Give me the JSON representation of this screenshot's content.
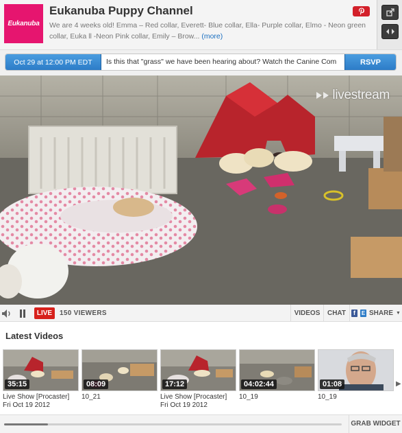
{
  "channel": {
    "logo_text": "Eukanuba",
    "title": "Eukanuba Puppy Channel",
    "description": "We are 4 weeks old! Emma – Red collar, Everett- Blue collar, Ella- Purple collar, Elmo - Neon green collar, Euka ll -Neon Pink collar, Emily – Brow...",
    "more_label": "(more)"
  },
  "event": {
    "date": "Oct 29 at 12:00 PM EDT",
    "description": "Is this that \"grass\" we have been hearing about? Watch the Canine Com",
    "rsvp_label": "RSVP"
  },
  "video": {
    "watermark": "livestream"
  },
  "controls": {
    "live_label": "LIVE",
    "viewers": "150 VIEWERS",
    "videos_label": "VIDEOS",
    "chat_label": "CHAT",
    "share_label": "SHARE"
  },
  "latest": {
    "title": "Latest Videos",
    "items": [
      {
        "duration": "35:15",
        "title": "Live Show [Procaster]",
        "date": "Fri Oct 19 2012"
      },
      {
        "duration": "08:09",
        "title": "10_21",
        "date": ""
      },
      {
        "duration": "17:12",
        "title": "Live Show [Procaster]",
        "date": "Fri Oct 19 2012"
      },
      {
        "duration": "04:02:44",
        "title": "10_19",
        "date": ""
      },
      {
        "duration": "01:08",
        "title": "10_19",
        "date": ""
      }
    ]
  },
  "footer": {
    "grab_widget_label": "GRAB WIDGET",
    "scroll_fraction": 0.13
  },
  "colors": {
    "brand_pink": "#e6156f",
    "accent_blue": "#2d7cc7",
    "live_red": "#d7211c"
  }
}
